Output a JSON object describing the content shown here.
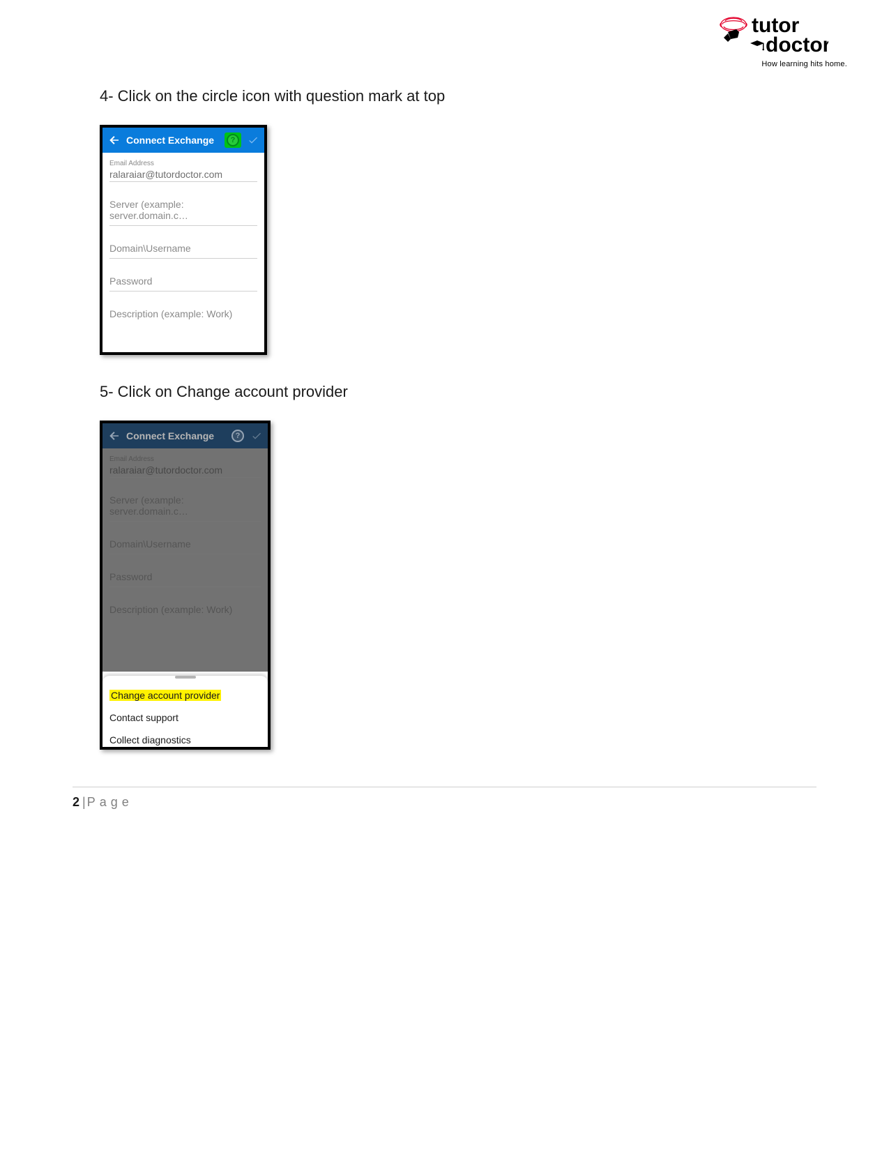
{
  "logo": {
    "word_top": "tutor",
    "word_bottom": "doctor",
    "tagline": "How learning hits home."
  },
  "steps": {
    "s4": "4-  Click on the circle icon with question mark at top",
    "s5": "5-  Click on Change account provider"
  },
  "screen": {
    "title": "Connect Exchange",
    "help_glyph": "?",
    "email_label": "Email Address",
    "email_value": "ralaraiar@tutordoctor.com",
    "server_placeholder": "Server (example: server.domain.c…",
    "domain_placeholder": "Domain\\Username",
    "password_placeholder": "Password",
    "description_placeholder": "Description (example: Work)"
  },
  "sheet": {
    "item1": "Change account provider",
    "item2": "Contact support",
    "item3": "Collect diagnostics"
  },
  "footer": {
    "page_number": "2",
    "page_label": "Page"
  }
}
